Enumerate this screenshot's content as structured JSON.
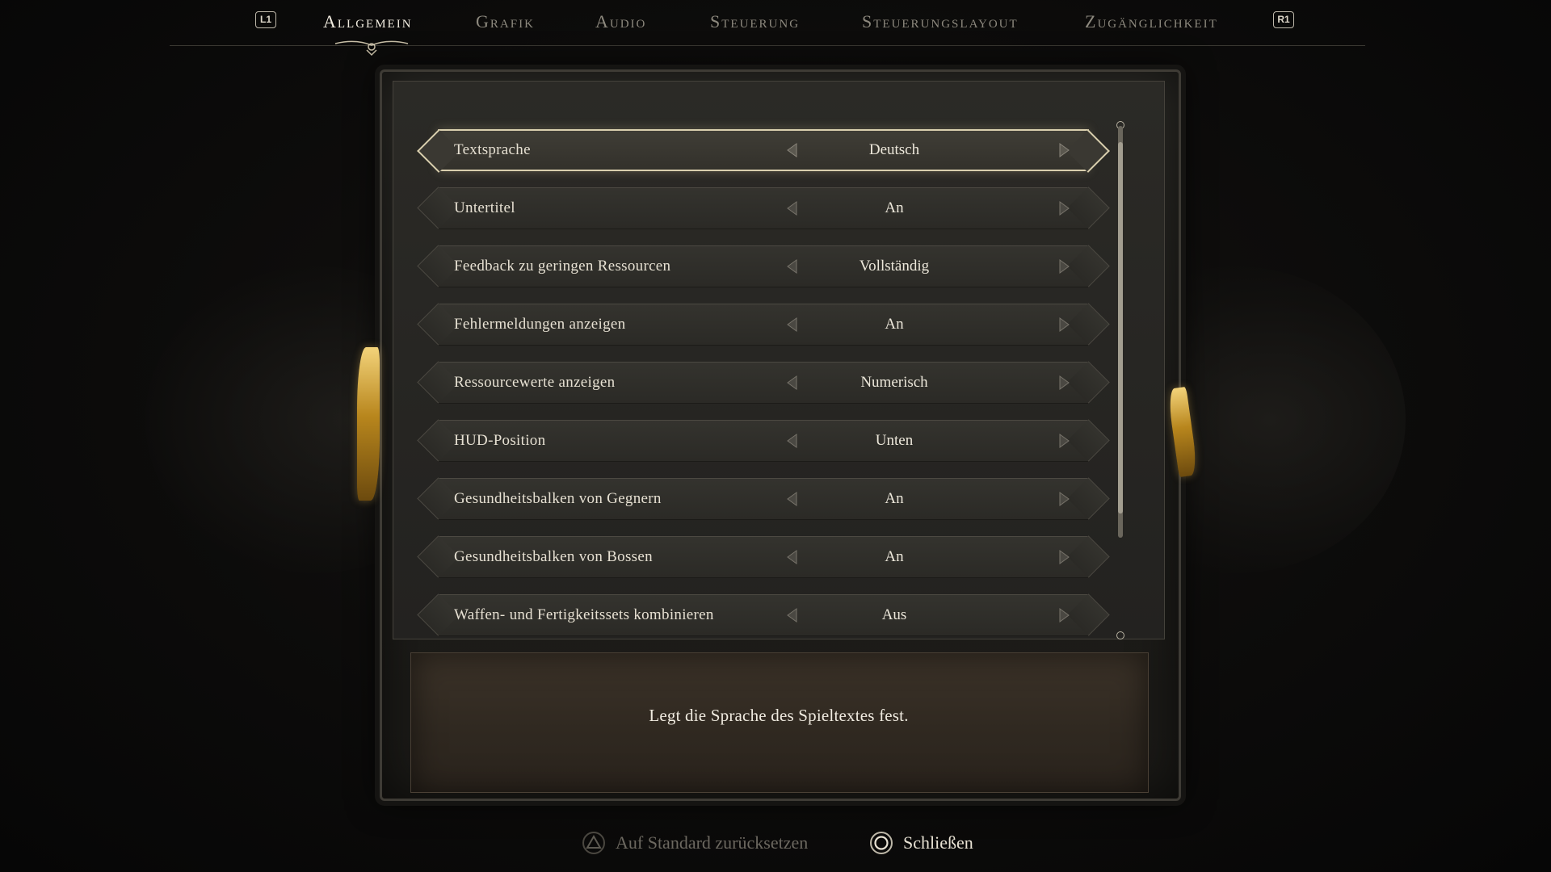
{
  "tabs": [
    {
      "label": "Allgemein",
      "active": true
    },
    {
      "label": "Grafik",
      "active": false
    },
    {
      "label": "Audio",
      "active": false
    },
    {
      "label": "Steuerung",
      "active": false
    },
    {
      "label": "Steuerungslayout",
      "active": false
    },
    {
      "label": "Zugänglichkeit",
      "active": false
    }
  ],
  "shoulder_buttons": {
    "left": "L1",
    "right": "R1"
  },
  "settings": [
    {
      "label": "Textsprache",
      "value": "Deutsch",
      "selected": true
    },
    {
      "label": "Untertitel",
      "value": "An"
    },
    {
      "label": "Feedback zu geringen Ressourcen",
      "value": "Vollständig"
    },
    {
      "label": "Fehlermeldungen anzeigen",
      "value": "An"
    },
    {
      "label": "Ressourcewerte anzeigen",
      "value": "Numerisch"
    },
    {
      "label": "HUD-Position",
      "value": "Unten"
    },
    {
      "label": "Gesundheitsbalken von Gegnern",
      "value": "An"
    },
    {
      "label": "Gesundheitsbalken von Bossen",
      "value": "An"
    },
    {
      "label": "Waffen- und Fertigkeitssets kombinieren",
      "value": "Aus"
    }
  ],
  "description": "Legt die Sprache des Spieltextes fest.",
  "footer": {
    "reset_label": "Auf Standard zurücksetzen",
    "reset_icon": "triangle-button-icon",
    "close_label": "Schließen",
    "close_icon": "circle-button-icon"
  },
  "colors": {
    "accent_gold": "#d9cfae",
    "active_tab": "#f1ece0",
    "inactive_tab": "#8d897e"
  }
}
